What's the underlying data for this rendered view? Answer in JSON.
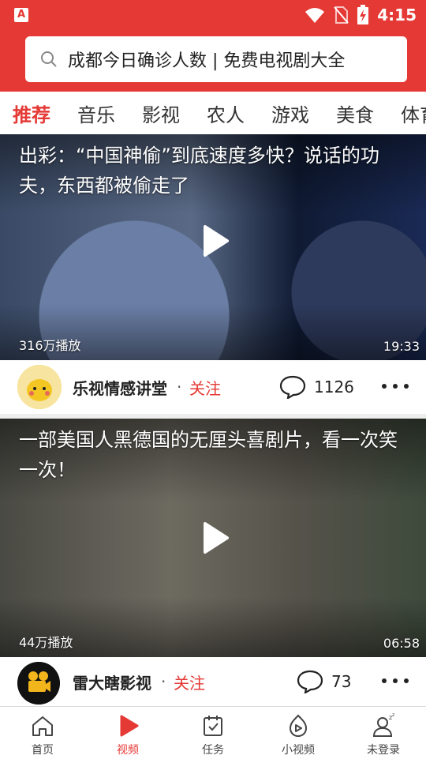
{
  "status_bar": {
    "time": "4:15"
  },
  "search": {
    "text": "成都今日确诊人数 | 免费电视剧大全"
  },
  "tabs": [
    "推荐",
    "音乐",
    "影视",
    "农人",
    "游戏",
    "美食",
    "体育"
  ],
  "videos": [
    {
      "title": "出彩：“中国神偷”到底速度多快？说话的功夫，东西都被偷走了",
      "plays": "316万播放",
      "duration": "19:33",
      "author": "乐视情感讲堂",
      "follow": "关注",
      "comments": "1126"
    },
    {
      "title": "一部美国人黑德国的无厘头喜剧片，看一次笑一次！",
      "plays": "44万播放",
      "duration": "06:58",
      "author": "雷大瞎影视",
      "follow": "关注",
      "comments": "73"
    }
  ],
  "bottom_nav": [
    "首页",
    "视频",
    "任务",
    "小视频",
    "未登录"
  ],
  "colors": {
    "accent": "#e53935"
  }
}
